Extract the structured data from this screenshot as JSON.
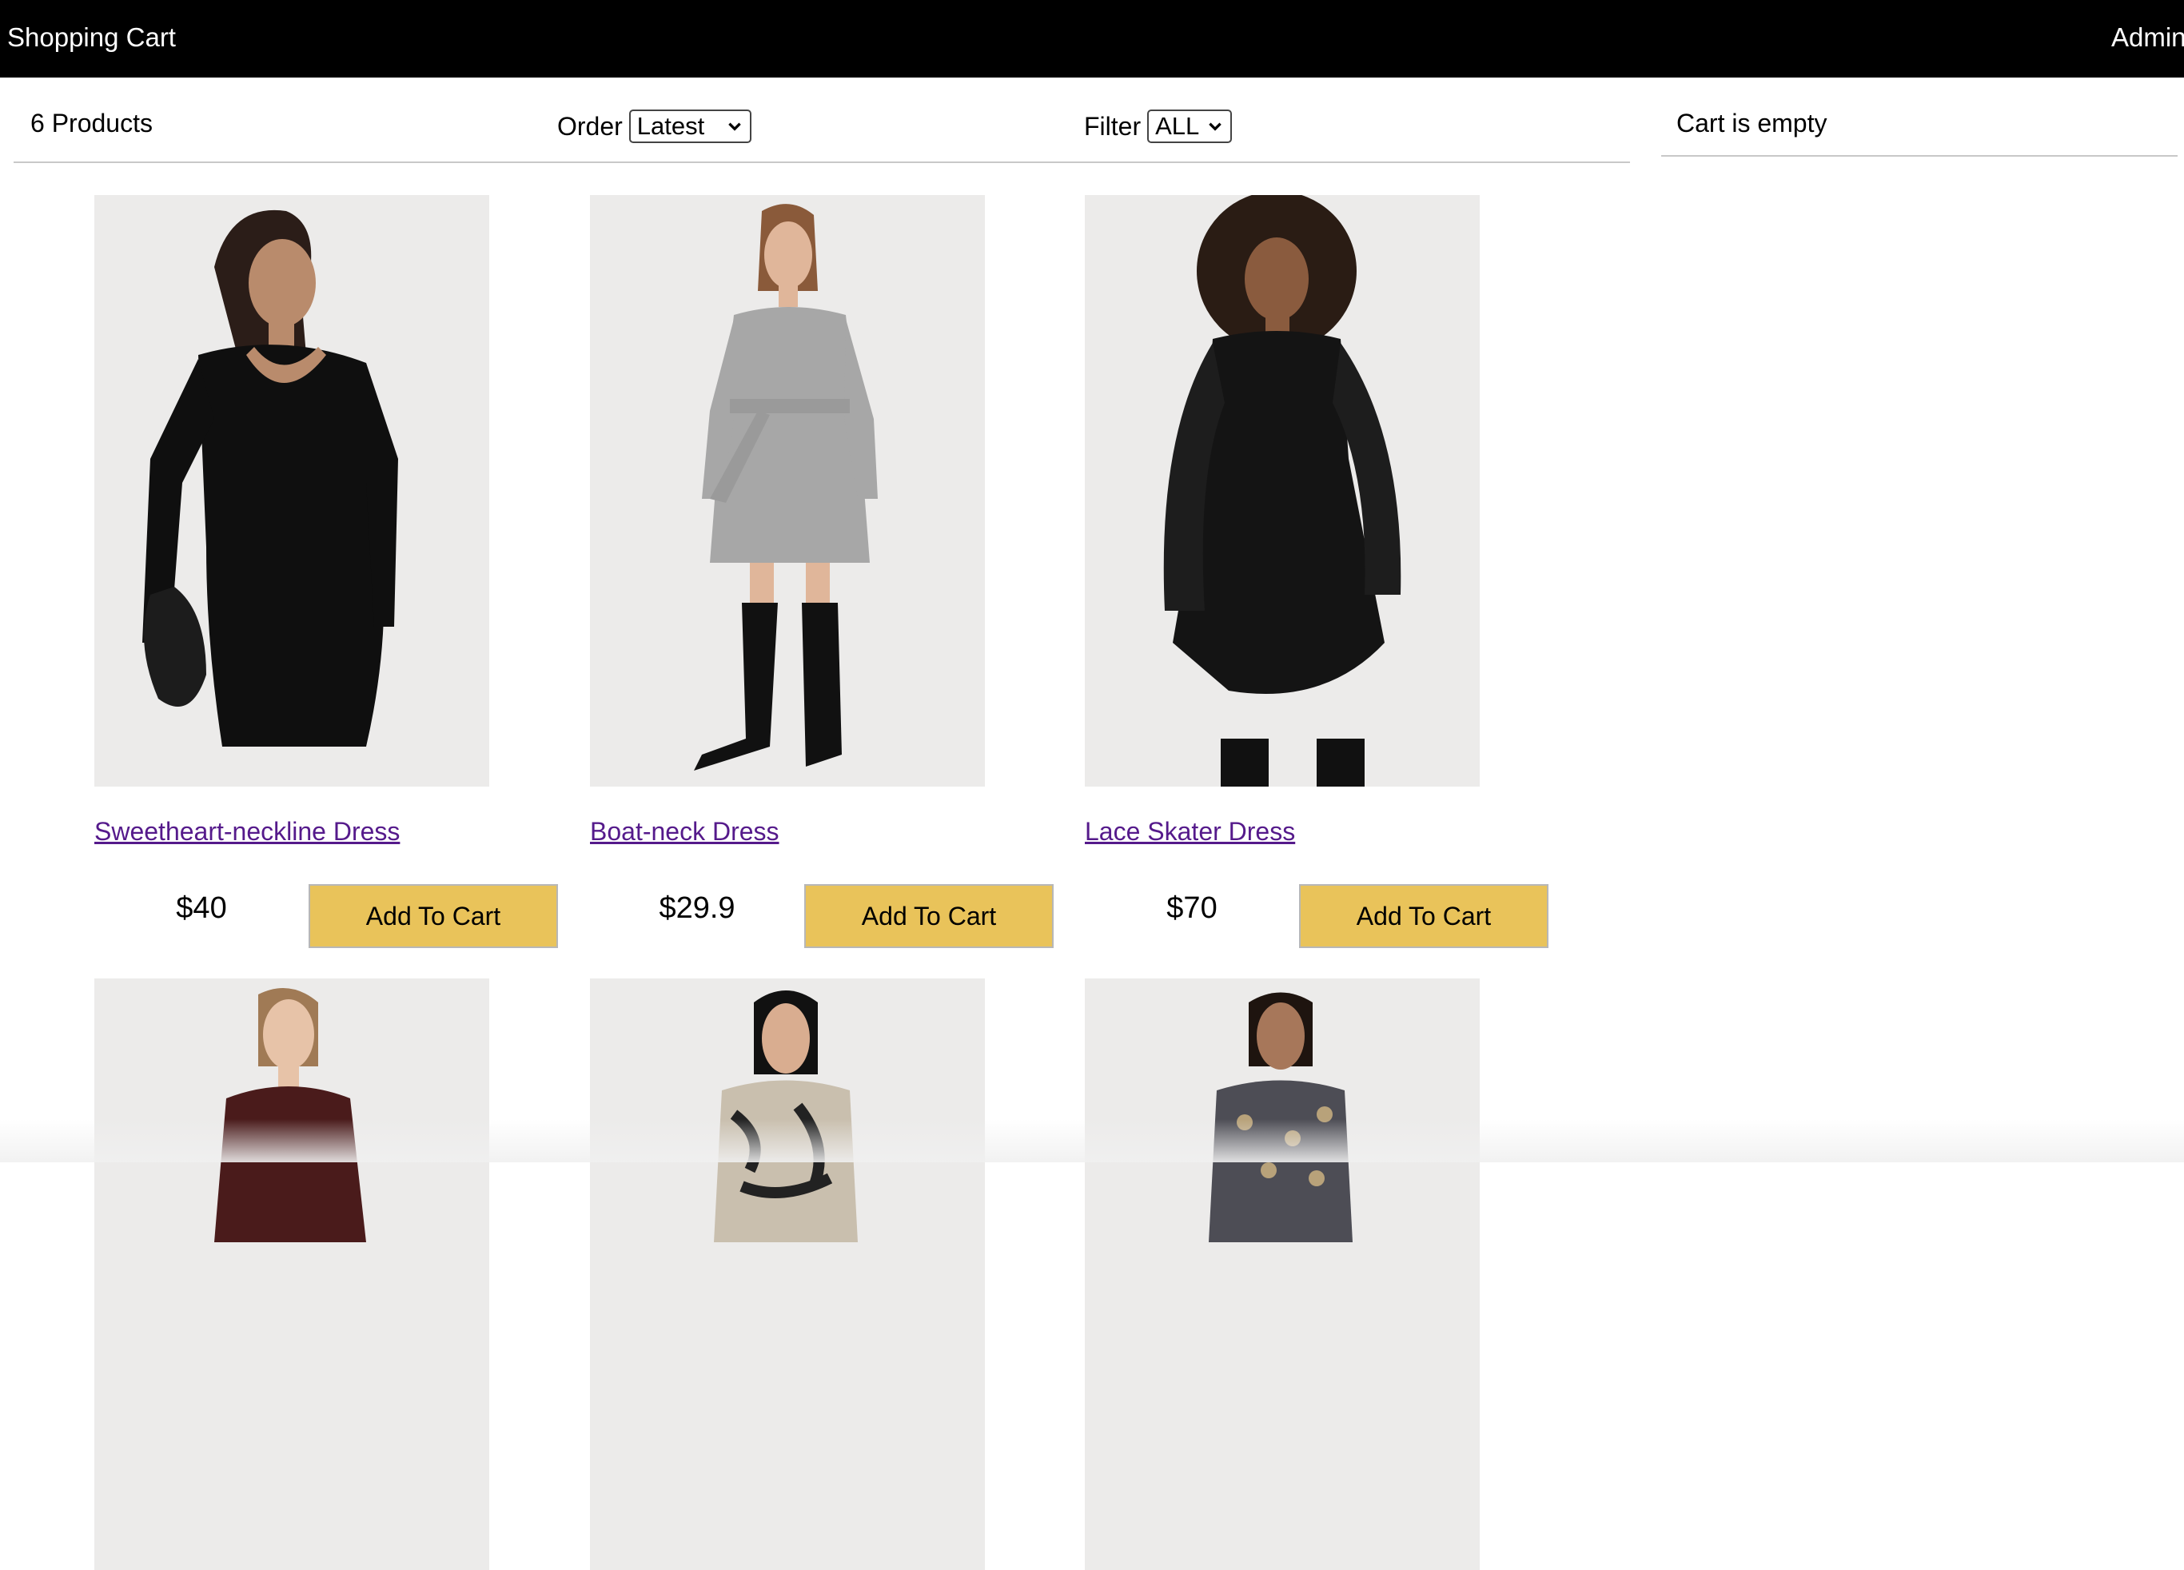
{
  "header": {
    "brand": "Shopping Cart",
    "admin": "Admin"
  },
  "filter": {
    "count_text": "6 Products",
    "order_label": "Order",
    "order_value": "Latest",
    "filter_label": "Filter",
    "filter_value": "ALL"
  },
  "cart": {
    "status": "Cart is empty"
  },
  "buttons": {
    "add_to_cart": "Add To Cart"
  },
  "products": [
    {
      "title": "Sweetheart-neckline Dress",
      "price": "$40"
    },
    {
      "title": "Boat-neck Dress",
      "price": "$29.9"
    },
    {
      "title": "Lace Skater Dress",
      "price": "$70"
    },
    {
      "title": "",
      "price": ""
    },
    {
      "title": "",
      "price": ""
    },
    {
      "title": "",
      "price": ""
    }
  ],
  "colors": {
    "topbar": "#000000",
    "button": "#e9c35a",
    "link": "#551a8b",
    "image_bg": "#ecebea"
  }
}
